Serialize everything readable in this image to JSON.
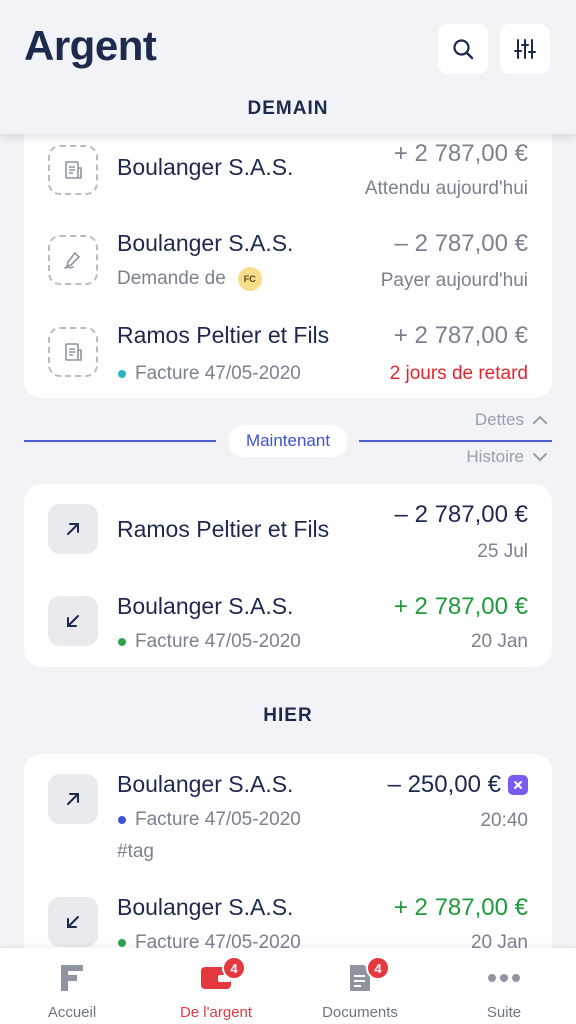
{
  "header": {
    "title": "Argent",
    "search_icon": "search-icon",
    "filter_icon": "sliders-icon"
  },
  "sections": {
    "tomorrow": "DEMAIN",
    "yesterday": "HIER"
  },
  "upcoming": [
    {
      "name": "Boulanger S.A.S.",
      "subtitle": "",
      "amount": "+ 2 787,00 €",
      "status": "Attendu aujourd'hui",
      "icon": "invoice-icon"
    },
    {
      "name": "Boulanger S.A.S.",
      "subtitle": "Demande de",
      "badge": "FC",
      "amount": "– 2 787,00 €",
      "status": "Payer aujourd'hui",
      "icon": "signature-icon"
    },
    {
      "name": "Ramos Peltier et Fils",
      "subtitle": "Facture 47/05-2020",
      "amount": "+ 2 787,00 €",
      "status": "2 jours de retard",
      "icon": "invoice-icon"
    }
  ],
  "divider": {
    "dettes": "Dettes",
    "now": "Maintenant",
    "histoire": "Histoire"
  },
  "recent": [
    {
      "name": "Ramos Peltier et Fils",
      "amount": "– 2 787,00 €",
      "date": "25 Jul",
      "icon": "arrow-up-right-icon"
    },
    {
      "name": "Boulanger S.A.S.",
      "subtitle": "Facture 47/05-2020",
      "amount": "+ 2 787,00 €",
      "date": "20 Jan",
      "icon": "arrow-down-left-icon"
    }
  ],
  "yesterday": [
    {
      "name": "Boulanger S.A.S.",
      "subtitle": "Facture 47/05-2020",
      "tag": "#tag",
      "amount": "– 250,00 €",
      "time": "20:40",
      "icon": "arrow-up-right-icon"
    },
    {
      "name": "Boulanger S.A.S.",
      "subtitle": "Facture 47/05-2020",
      "amount": "+ 2 787,00 €",
      "date": "20 Jan",
      "icon": "arrow-down-left-icon"
    }
  ],
  "nav": [
    {
      "label": "Accueil",
      "icon": "home-logo-icon"
    },
    {
      "label": "De l'argent",
      "icon": "wallet-icon",
      "badge": "4",
      "active": true
    },
    {
      "label": "Documents",
      "icon": "document-icon",
      "badge": "4"
    },
    {
      "label": "Suite",
      "icon": "more-icon"
    }
  ],
  "colors": {
    "primary": "#1d2a4d",
    "accent_blue": "#3d52d5",
    "positive": "#1f9a3b",
    "negative": "#e4252f",
    "active_nav": "#e4383f",
    "dot_teal": "#2bb3c0",
    "dot_green": "#2ea44f",
    "dot_blue": "#3d52d5",
    "badge_purple": "#7b5cf0"
  }
}
